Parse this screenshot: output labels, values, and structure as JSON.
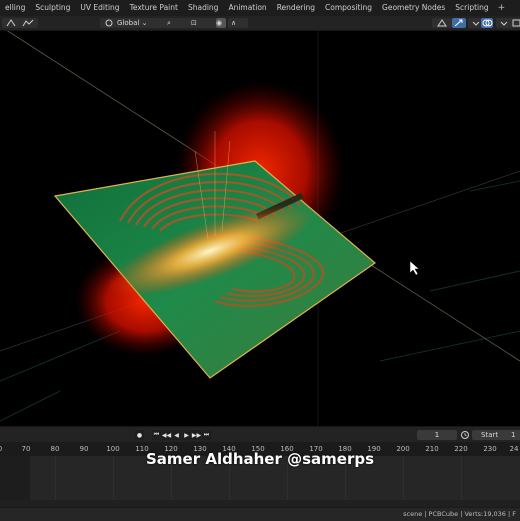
{
  "workspace_tabs": [
    {
      "label": "elling"
    },
    {
      "label": "Sculpting"
    },
    {
      "label": "UV Editing"
    },
    {
      "label": "Texture Paint"
    },
    {
      "label": "Shading"
    },
    {
      "label": "Animation"
    },
    {
      "label": "Rendering"
    },
    {
      "label": "Compositing"
    },
    {
      "label": "Geometry Nodes"
    },
    {
      "label": "Scripting"
    },
    {
      "label": "+"
    }
  ],
  "toolbar": {
    "orientation": "Global",
    "pivot_glyph": "⌕",
    "snap_glyph": "⊡",
    "proportional_glyph": "◉",
    "falloff_glyph": "∧"
  },
  "timeline": {
    "current_frame": "1",
    "start_label": "Start",
    "start_value": "1",
    "ruler_ticks": [
      "0",
      "70",
      "80",
      "90",
      "100",
      "110",
      "120",
      "130",
      "140",
      "150",
      "160",
      "170",
      "180",
      "190",
      "200",
      "210",
      "220",
      "230",
      "24"
    ]
  },
  "playback": [
    "●",
    "⏮",
    "◀◀",
    "◀",
    "▶",
    "▶▶",
    "⏭"
  ],
  "watermark": "Samer Aldhaher @samerps",
  "status": "scene | PCBCube | Verts:19,036 | F",
  "colors": {
    "board": "#1f8a4a",
    "board_edge": "#e3b34a",
    "glow_red": "#ff1a00",
    "glow_yellow": "#ffe68a",
    "accent_blue": "#3e6da8"
  }
}
